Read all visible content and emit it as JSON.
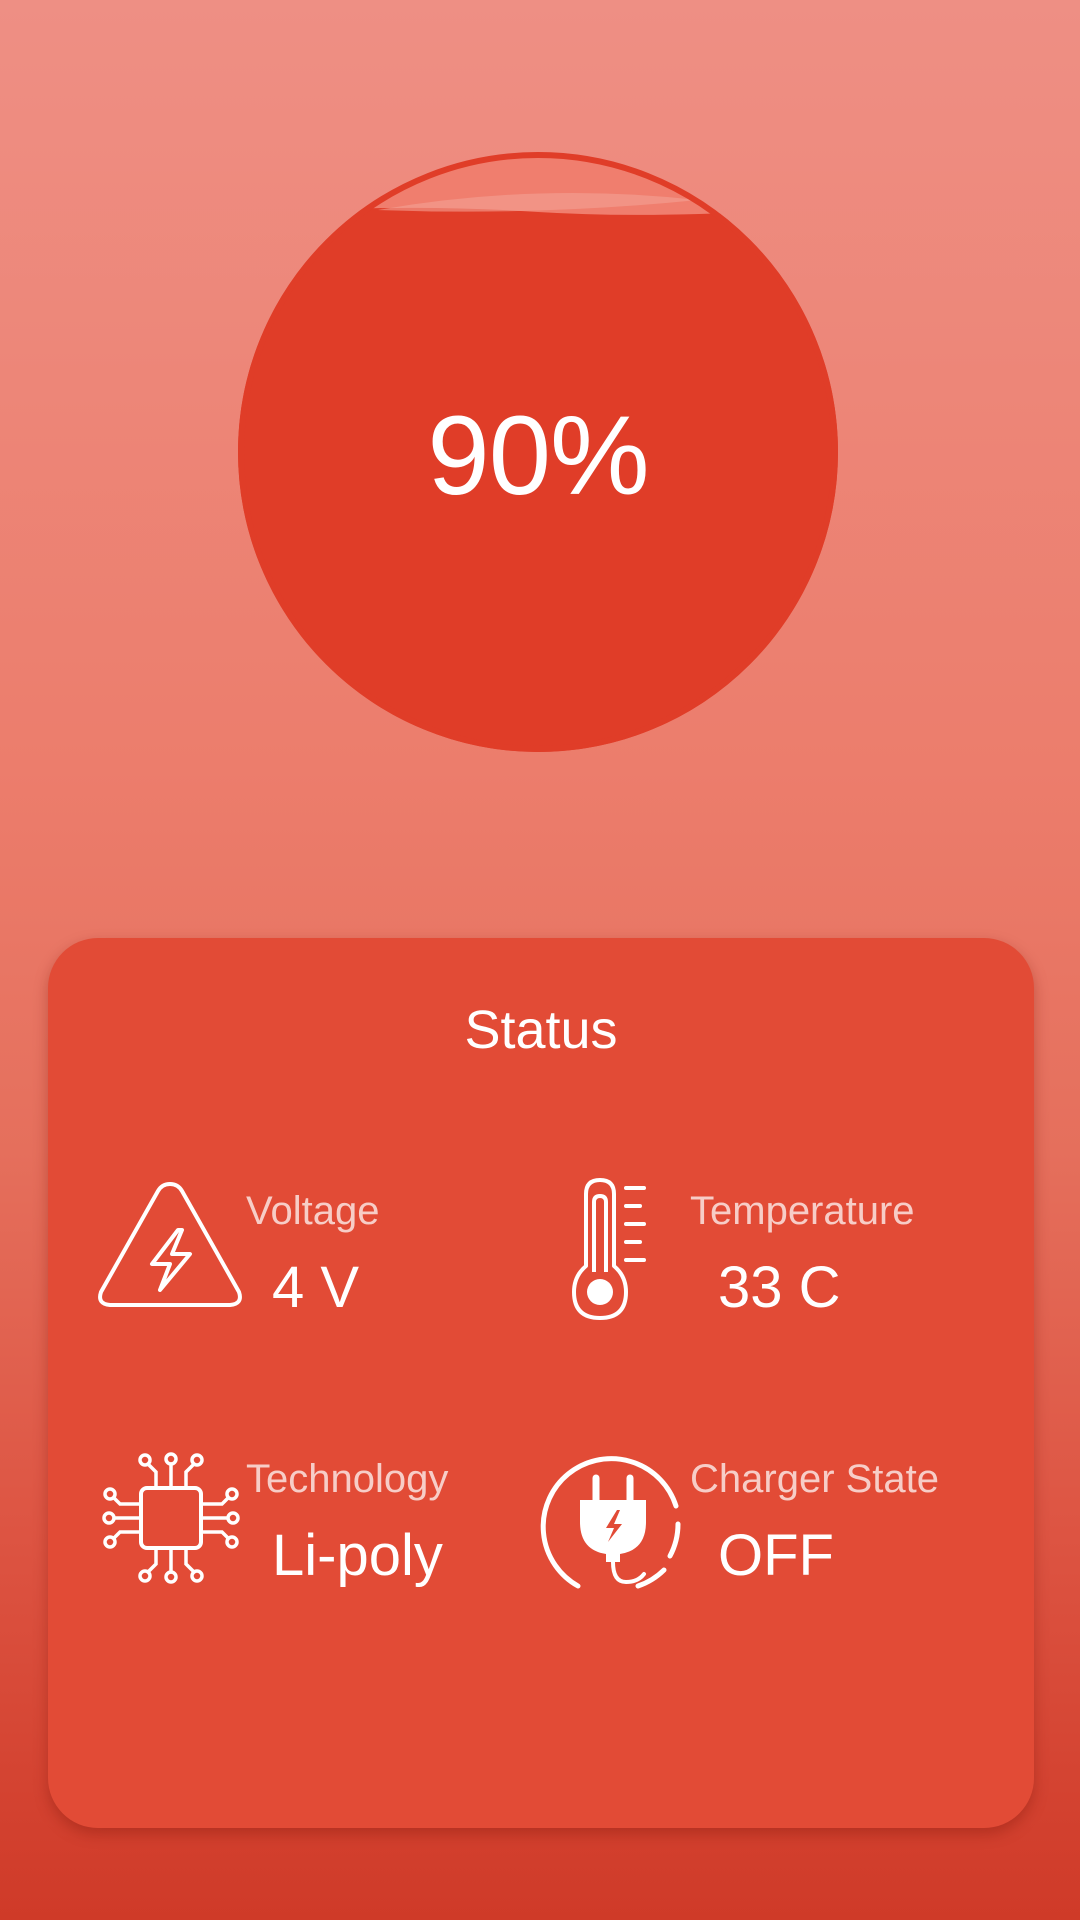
{
  "battery": {
    "level_text": "90%",
    "level": 0.9,
    "fill_color": "#e03d28",
    "highlight_color": "#f07e6e"
  },
  "status": {
    "title": "Status",
    "items": [
      {
        "label": "Voltage",
        "value": "4 V",
        "icon": "high-voltage-icon"
      },
      {
        "label": "Temperature",
        "value": "33 C",
        "icon": "thermometer-icon"
      },
      {
        "label": "Technology",
        "value": "Li-poly",
        "icon": "chip-icon"
      },
      {
        "label": "Charger State",
        "value": "OFF",
        "icon": "charger-plug-icon"
      }
    ]
  }
}
